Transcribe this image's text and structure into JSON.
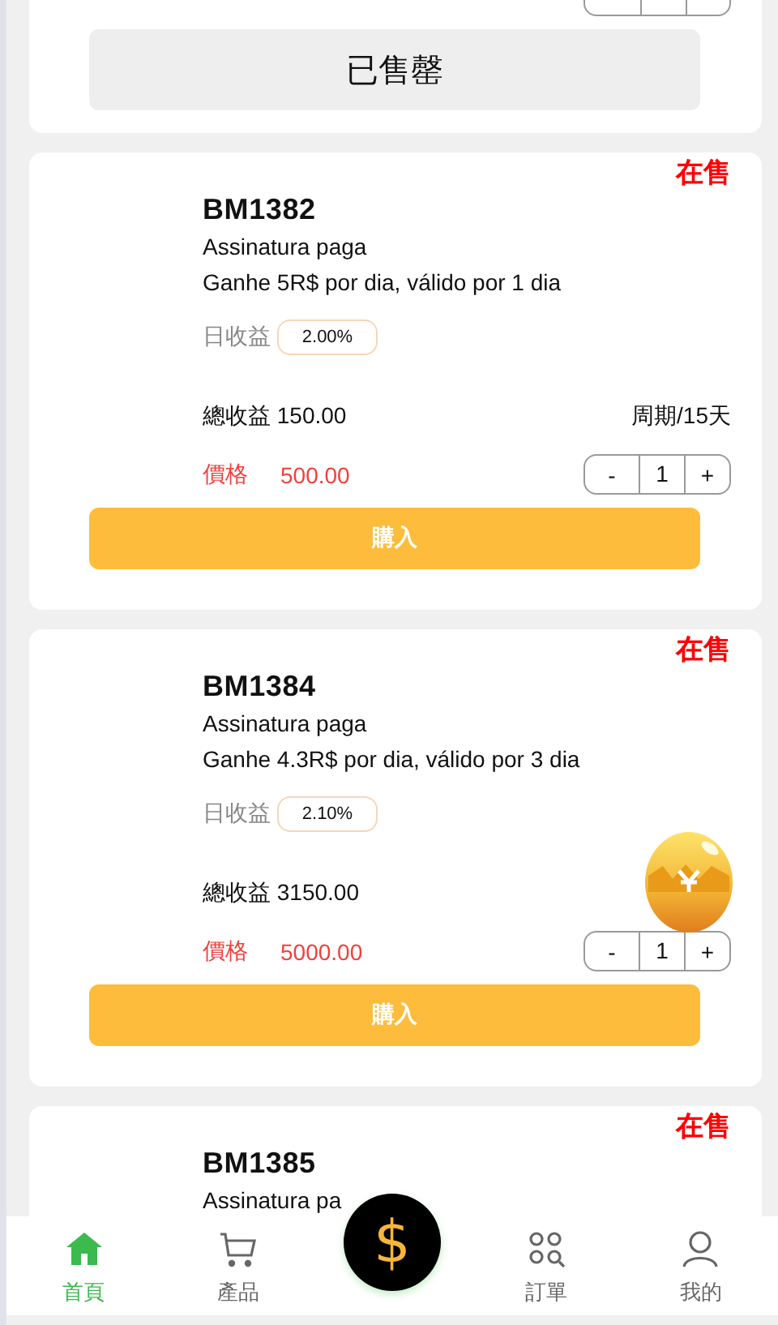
{
  "products": [
    {
      "sold_out": true,
      "stepper_outline": true,
      "button": "已售罄"
    },
    {
      "sold_out": false,
      "tag": "在售",
      "code": "BM1382",
      "subtitle": "Assinatura paga",
      "description": "Ganhe 5R$ por dia, válido por 1 dia",
      "daily_label": "日收益",
      "daily_rate": "2.00%",
      "total_label": "總收益",
      "total": "150.00",
      "period": "周期/15天",
      "price_label": "價格",
      "price": "500.00",
      "decrement": "-",
      "quantity": "1",
      "increment": "+",
      "button": "購入"
    },
    {
      "sold_out": false,
      "tag": "在售",
      "code": "BM1384",
      "subtitle": "Assinatura paga",
      "description": "Ganhe 4.3R$ por dia, válido por 3 dia",
      "daily_label": "日收益",
      "daily_rate": "2.10%",
      "total_label": "總收益",
      "total": "3150.00",
      "price_label": "價格",
      "price": "5000.00",
      "decrement": "-",
      "quantity": "1",
      "increment": "+",
      "button": "購入"
    },
    {
      "tag": "在售",
      "code": "BM1385",
      "subtitle": "Assinatura pa"
    }
  ],
  "nav": [
    {
      "kind": "tab",
      "label": "首頁",
      "selected": true
    },
    {
      "kind": "tab",
      "label": "產品",
      "selected": false
    },
    {
      "kind": "center",
      "symbol": "$"
    },
    {
      "kind": "tab",
      "label": "訂單",
      "selected": false
    },
    {
      "kind": "tab",
      "label": "我的",
      "selected": false
    }
  ]
}
